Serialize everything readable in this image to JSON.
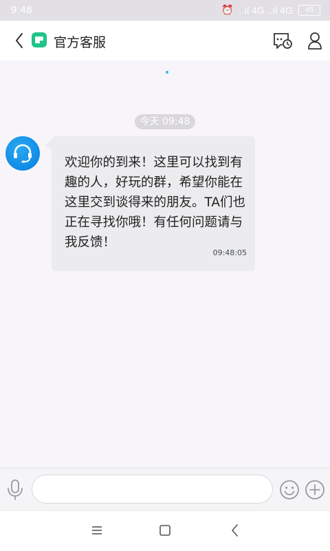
{
  "status_bar": {
    "time": "9:48",
    "signal_text": "..ıl 4G ..ıl 4G",
    "battery": "45"
  },
  "header": {
    "title": "官方客服",
    "icons": [
      "back-icon",
      "app-logo-icon",
      "chat-history-icon",
      "profile-icon"
    ]
  },
  "chat": {
    "date_label": "今天 09:48",
    "messages": [
      {
        "sender": "official-service",
        "text": "欢迎你的到来！这里可以找到有趣的人，好玩的群，希望你能在这里交到谈得来的朋友。TA们也正在寻找你哦！有任何问题请与我反馈！",
        "time": "09:48:05"
      }
    ]
  },
  "input_bar": {
    "value": "",
    "placeholder": ""
  },
  "colors": {
    "brand_green": "#20c389",
    "avatar_blue": "#0f8be6",
    "bubble": "#ececef",
    "background": "#f7f5f9"
  }
}
